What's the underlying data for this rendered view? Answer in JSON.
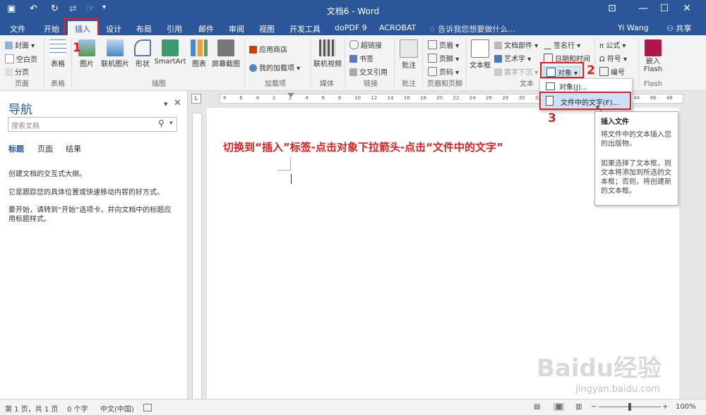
{
  "window": {
    "title": "文档6 - Word"
  },
  "tabs": [
    "文件",
    "开始",
    "插入",
    "设计",
    "布局",
    "引用",
    "邮件",
    "审阅",
    "视图",
    "开发工具",
    "doPDF 9",
    "ACROBAT"
  ],
  "tell_me": "告诉我您想要做什么...",
  "user": "Yi Wang",
  "share": "共享",
  "ribbon": {
    "pages": {
      "items": [
        "封面",
        "空白页",
        "分页"
      ],
      "group": "页面"
    },
    "table": {
      "label": "表格",
      "group": "表格"
    },
    "illus": {
      "items": [
        "图片",
        "联机图片",
        "形状",
        "SmartArt",
        "图表",
        "屏幕截图"
      ],
      "group": "插图"
    },
    "addins": {
      "items": [
        "应用商店",
        "我的加载项"
      ],
      "group": "加载项"
    },
    "media": {
      "label": "联机视频",
      "group": "媒体"
    },
    "links": {
      "items": [
        "超链接",
        "书签",
        "交叉引用"
      ],
      "group": "链接"
    },
    "comments": {
      "label": "批注",
      "group": "批注"
    },
    "hf": {
      "items": [
        "页眉",
        "页脚",
        "页码"
      ],
      "group": "页眉和页脚"
    },
    "text": {
      "textbox": "文本框",
      "items": [
        "文档部件",
        "艺术字",
        "首字下沉",
        "签名行",
        "日期和时间",
        "对象"
      ],
      "group": "文本"
    },
    "symbols": {
      "items": [
        "公式",
        "符号",
        "编号"
      ]
    },
    "flash": {
      "label": "嵌入\nFlash",
      "group": "Flash"
    }
  },
  "dropdown": {
    "items": [
      "对象(J)...",
      "文件中的文字(F)..."
    ]
  },
  "tooltip": {
    "title": "插入文件",
    "p1": "将文件中的文本插入您的出版物。",
    "p2": "如果选择了文本框，则文本将添加到所选的文本框；否则，将创建新的文本框。"
  },
  "nav": {
    "title": "导航",
    "search_placeholder": "搜索文档",
    "tabs": [
      "标题",
      "页面",
      "结果"
    ],
    "text1": "创建文档的交互式大纲。",
    "text2": "它是跟踪您的具体位置或快速移动内容的好方式。",
    "text3": "要开始，请转到“开始”选项卡，并向文档中的标题应用标题样式。"
  },
  "ruler": {
    "ticks": [
      "8",
      "6",
      "4",
      "2",
      "2",
      "4",
      "6",
      "8",
      "10",
      "12",
      "14",
      "16",
      "18",
      "20",
      "22",
      "24",
      "26",
      "28",
      "30",
      "32",
      "34",
      "36",
      "38",
      "40",
      "42",
      "44",
      "46",
      "48"
    ]
  },
  "instruction": "切换到“插入”标签-点击对象下拉箭头-点击“文件中的文字”",
  "annotations": [
    "1",
    "2",
    "3"
  ],
  "status": {
    "page": "第 1 页，共 1 页",
    "words": "0 个字",
    "lang": "中文(中国)",
    "zoom": "100%"
  },
  "watermark": {
    "main": "Baidu经验",
    "sub": "jingyan.baidu.com"
  },
  "colors": {
    "accent": "#2b579a",
    "annotation": "#e02020"
  }
}
